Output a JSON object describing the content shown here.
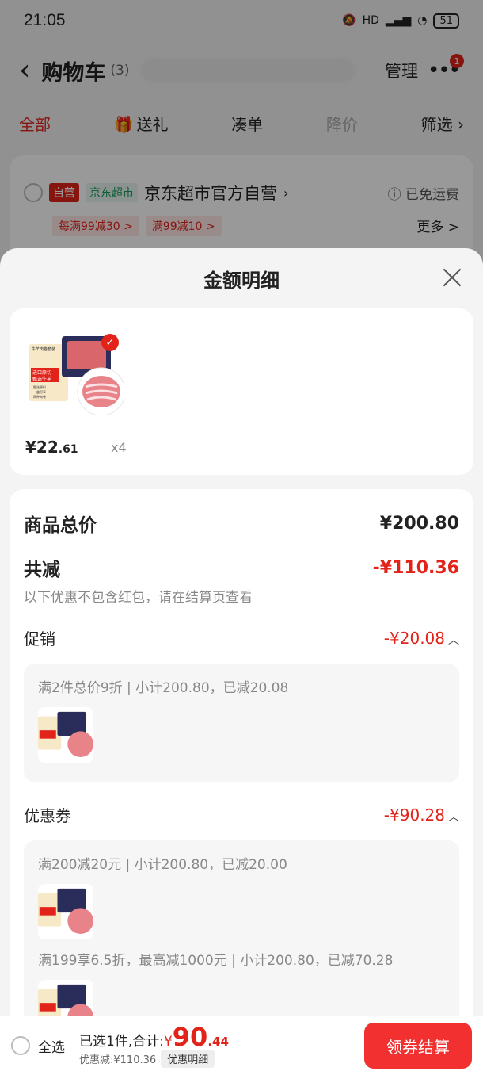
{
  "status_bar": {
    "time": "21:05",
    "signal": "HD",
    "battery": "51"
  },
  "nav": {
    "title": "购物车",
    "count": "(3)",
    "manage": "管理",
    "badge": "1"
  },
  "tabs": [
    {
      "label": "全部"
    },
    {
      "label": "送礼"
    },
    {
      "label": "凑单"
    },
    {
      "label": "降价"
    },
    {
      "label": "筛选"
    }
  ],
  "shop": {
    "tag_self": "自营",
    "tag_supermarket": "京东超市",
    "name": "京东超市官方自营",
    "free_ship": "ⓘ 已免运费",
    "promos": [
      "每满99减30 >",
      "满99减10 >"
    ],
    "more": "更多 >"
  },
  "sheet": {
    "title": "金额明细",
    "item": {
      "price_int": "¥22",
      "price_dec": ".61",
      "qty": "x4",
      "image_text": {
        "line1": "牛羊肉卷套装",
        "line2": "进口原切",
        "line3": "甄选牛羊",
        "bullets": [
          "甄选原料",
          "一盒尽享",
          "两种肉卷"
        ]
      }
    },
    "total_label": "商品总价",
    "total_value": "¥200.80",
    "reduce_label": "共减",
    "reduce_value": "-¥110.36",
    "reduce_note": "以下优惠不包含红包，请在结算页查看",
    "promo_label": "促销",
    "promo_value": "-¥20.08",
    "promo_desc": "满2件总价9折 | 小计200.80，已减20.08",
    "coupon_label": "优惠券",
    "coupon_value": "-¥90.28",
    "coupon_desc1": "满200减20元 | 小计200.80，已减20.00",
    "coupon_desc2": "满199享6.5折，最高减1000元 | 小计200.80，已减70.28"
  },
  "bottom": {
    "select_all": "全选",
    "selected": "已选1件,合计:",
    "currency": "¥",
    "total_int": "90",
    "total_dec": ".44",
    "discount": "优惠减:¥110.36",
    "detail_pill": "优惠明细",
    "checkout": "领券结算"
  },
  "colors": {
    "accent": "#e2231a",
    "checkout": "#f23030"
  }
}
